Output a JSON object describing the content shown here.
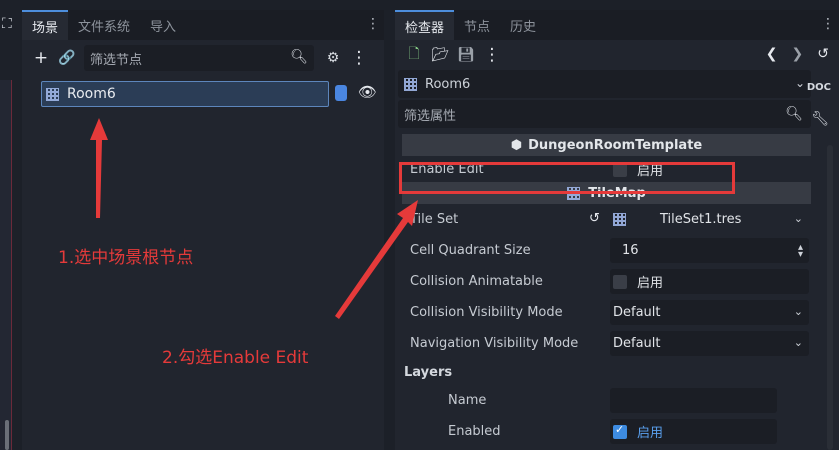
{
  "scene_dock": {
    "tabs": [
      "场景",
      "文件系统",
      "导入"
    ],
    "filter_placeholder": "筛选节点",
    "root_node": "Room6"
  },
  "inspector": {
    "tabs": [
      "检查器",
      "节点",
      "历史"
    ],
    "object_name": "Room6",
    "filter_placeholder": "筛选属性",
    "section_script": "DungeonRoomTemplate",
    "section_tilemap": "TileMap",
    "props": [
      {
        "name": "Enable Edit",
        "value": "启用"
      },
      {
        "name": "Tile Set",
        "value": "TileSet1.tres"
      },
      {
        "name": "Cell Quadrant Size",
        "value": "16"
      },
      {
        "name": "Collision Animatable",
        "value": "启用"
      },
      {
        "name": "Collision Visibility Mode",
        "value": "Default"
      },
      {
        "name": "Navigation Visibility Mode",
        "value": "Default"
      }
    ],
    "layers_title": "Layers",
    "layer_props": [
      {
        "name": "Name",
        "value": ""
      },
      {
        "name": "Enabled",
        "value": "启用"
      }
    ]
  },
  "annotations": {
    "step1": "1.选中场景根节点",
    "step2": "2.勾选Enable Edit",
    "color": "#e53a3a"
  }
}
